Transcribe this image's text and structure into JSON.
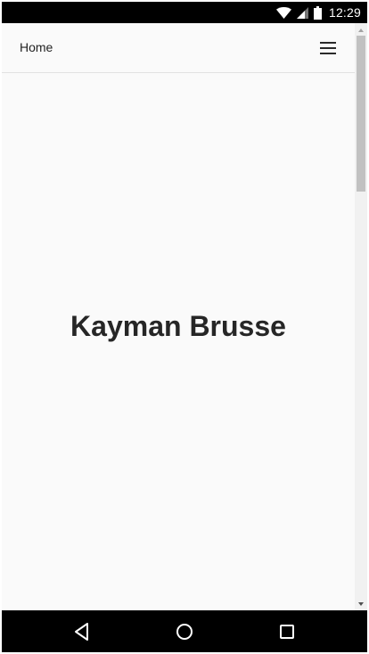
{
  "status_bar": {
    "time": "12:29",
    "icons": [
      "wifi-icon",
      "signal-icon",
      "battery-icon"
    ]
  },
  "navbar": {
    "home_label": "Home",
    "menu_icon": "hamburger-menu-icon"
  },
  "hero": {
    "title": "Kayman Brusse"
  },
  "system_nav": {
    "buttons": [
      "back-icon",
      "home-circle-icon",
      "recents-square-icon"
    ]
  },
  "colors": {
    "status_bar_bg": "#000000",
    "page_bg": "#fafafa",
    "text": "#262626",
    "nav_bar_bg": "#000000"
  }
}
